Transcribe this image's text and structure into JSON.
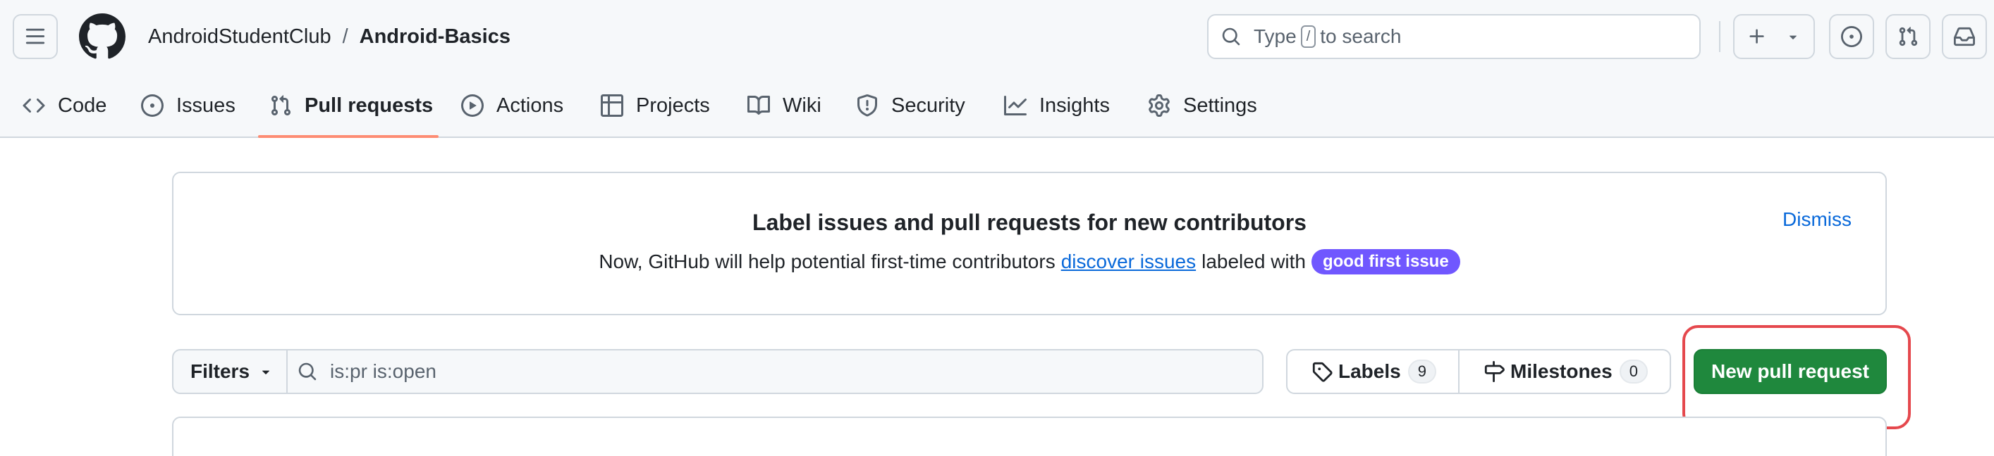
{
  "header": {
    "breadcrumb": {
      "owner": "AndroidStudentClub",
      "separator": "/",
      "repo": "Android-Basics"
    },
    "search": {
      "prefix": "Type",
      "key": "/",
      "suffix": "to search"
    },
    "icons": [
      "hamburger-icon",
      "github-logo-icon",
      "search-icon",
      "plus-icon",
      "chevron-down-icon",
      "issue-opened-icon",
      "git-pull-request-icon",
      "inbox-icon"
    ]
  },
  "nav": {
    "tabs": [
      {
        "label": "Code",
        "icon": "code-icon"
      },
      {
        "label": "Issues",
        "icon": "issue-opened-icon"
      },
      {
        "label": "Pull requests",
        "icon": "git-pull-request-icon",
        "active": true
      },
      {
        "label": "Actions",
        "icon": "play-icon"
      },
      {
        "label": "Projects",
        "icon": "table-icon"
      },
      {
        "label": "Wiki",
        "icon": "book-icon"
      },
      {
        "label": "Security",
        "icon": "shield-icon"
      },
      {
        "label": "Insights",
        "icon": "graph-icon"
      },
      {
        "label": "Settings",
        "icon": "gear-icon"
      }
    ]
  },
  "banner": {
    "title": "Label issues and pull requests for new contributors",
    "text_before": "Now, GitHub will help potential first-time contributors",
    "link": "discover issues",
    "text_after": "labeled with",
    "label": "good first issue",
    "dismiss": "Dismiss"
  },
  "toolbar": {
    "filters_label": "Filters",
    "filter_value": "is:pr is:open",
    "labels_label": "Labels",
    "labels_count": "9",
    "milestones_label": "Milestones",
    "milestones_count": "0",
    "new_pr_label": "New pull request"
  },
  "colors": {
    "accent_blue": "#0969da",
    "primary_green": "#1f883d",
    "label_purple": "#7057ff",
    "active_tab_underline": "#fd8c73",
    "highlight_red": "#e5484d"
  }
}
